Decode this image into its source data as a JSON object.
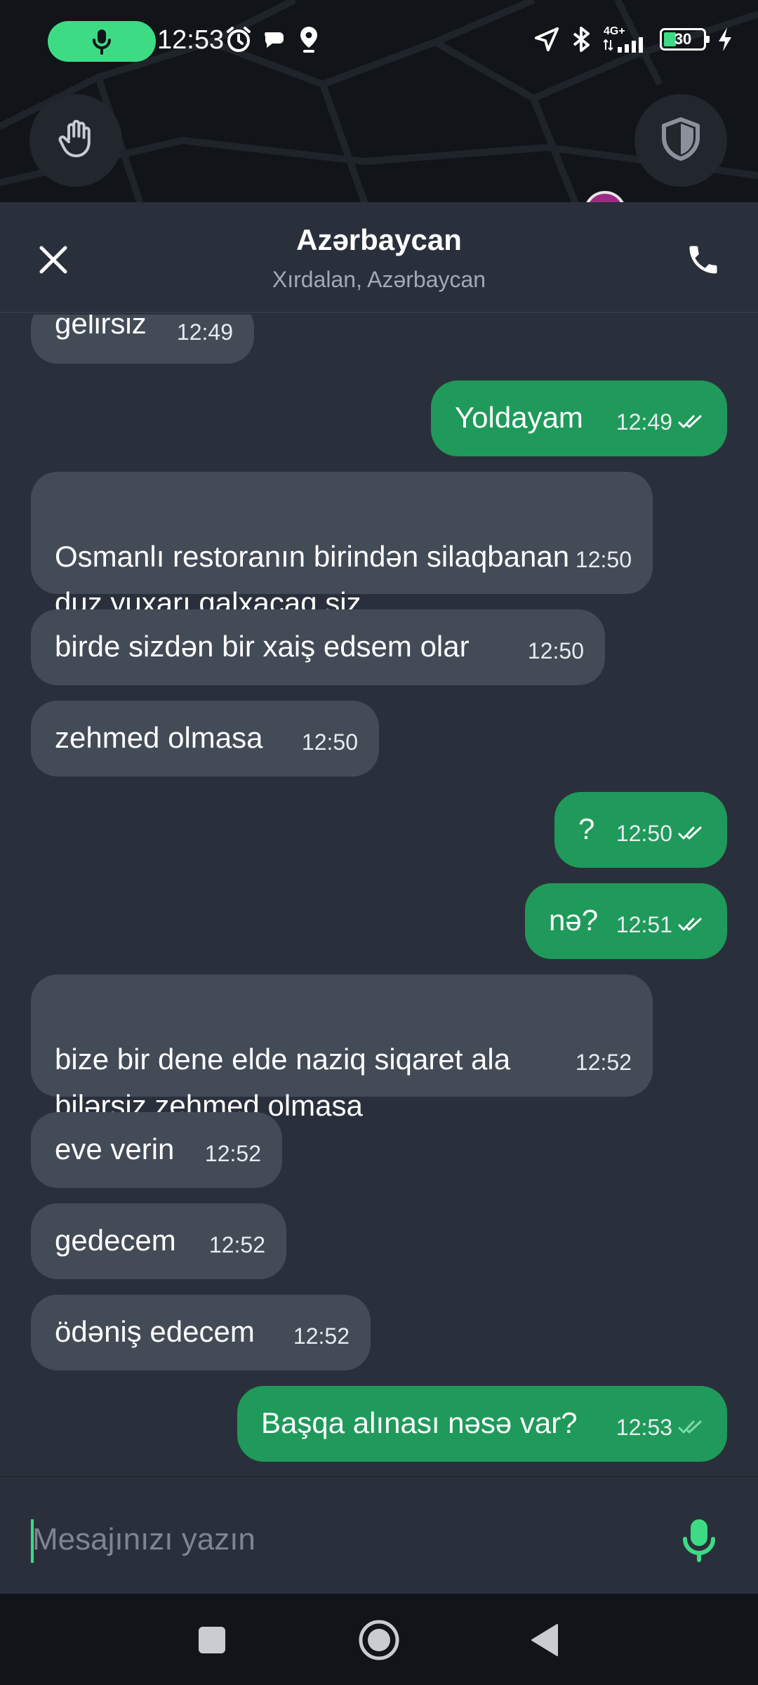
{
  "status_bar": {
    "time": "12:53",
    "network": "4G+",
    "battery": "30"
  },
  "chat": {
    "title": "Azərbaycan",
    "subtitle": "Xırdalan, Azərbaycan"
  },
  "messages": [
    {
      "dir": "in",
      "text": "gelirsiz",
      "time": "12:49"
    },
    {
      "dir": "out",
      "text": "Yoldayam",
      "time": "12:49"
    },
    {
      "dir": "in",
      "text": "Osmanlı restoranın birindən silaqbanan\nduz yuxarı qalxacaq siz",
      "time": "12:50"
    },
    {
      "dir": "in",
      "text": "birde sizdən bir xaiş edsem olar",
      "time": "12:50"
    },
    {
      "dir": "in",
      "text": "zehmed olmasa",
      "time": "12:50"
    },
    {
      "dir": "out",
      "text": "?",
      "time": "12:50"
    },
    {
      "dir": "out",
      "text": "nə?",
      "time": "12:51"
    },
    {
      "dir": "in",
      "text": "bize bir dene elde naziq siqaret ala\nbilərsiz zehmed olmasa",
      "time": "12:52"
    },
    {
      "dir": "in",
      "text": "eve verin",
      "time": "12:52"
    },
    {
      "dir": "in",
      "text": "gedecem",
      "time": "12:52"
    },
    {
      "dir": "in",
      "text": "ödəniş edecem",
      "time": "12:52"
    },
    {
      "dir": "out",
      "text": "Başqa alınası nəsə var?",
      "time": "12:53"
    }
  ],
  "composer": {
    "placeholder": "Mesajınızı yazın"
  },
  "colors": {
    "accent": "#3ddc84",
    "outgoing_bubble": "#1f9a5a",
    "incoming_bubble": "#434b57",
    "background": "#2a303b"
  }
}
